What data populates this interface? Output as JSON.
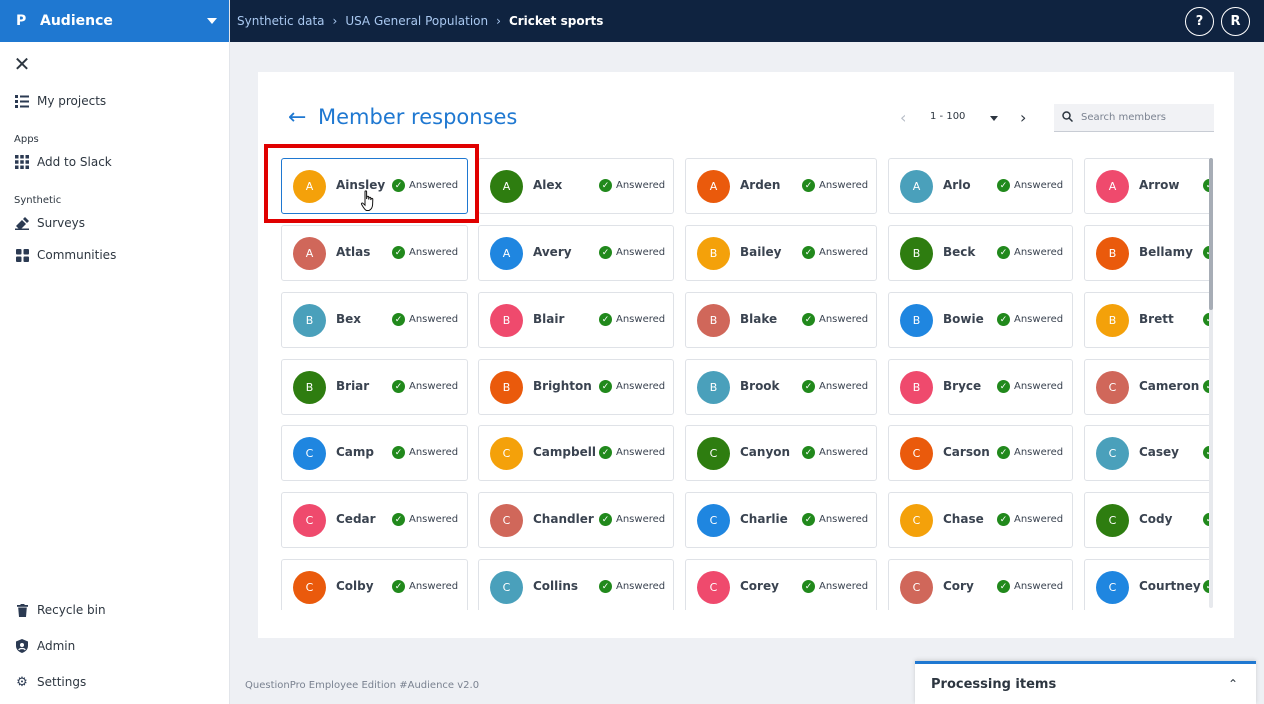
{
  "app": {
    "logo": "P",
    "name": "Audience"
  },
  "sidebar": {
    "close_icon": "close-icon",
    "my_projects": "My projects",
    "apps_section": "Apps",
    "add_to_slack": "Add to Slack",
    "synthetic_section": "Synthetic",
    "surveys": "Surveys",
    "communities": "Communities",
    "recycle_bin": "Recycle bin",
    "admin": "Admin",
    "settings": "Settings"
  },
  "breadcrumb": [
    "Synthetic data",
    "USA General Population",
    "Cricket sports"
  ],
  "topbar": {
    "help": "?",
    "user_initial": "R"
  },
  "page": {
    "title": "Member responses",
    "pager_range": "1 - 100",
    "search_placeholder": "Search members"
  },
  "status_label": "Answered",
  "colors": {
    "accent": "#1f78d1",
    "topbar": "#0f2340",
    "answered": "#21891c",
    "highlight": "#e00000"
  },
  "members": [
    [
      {
        "initial": "A",
        "name": "Ainsley",
        "color": "#f4a10a"
      },
      {
        "initial": "A",
        "name": "Alex",
        "color": "#2e7d10"
      },
      {
        "initial": "A",
        "name": "Arden",
        "color": "#ea5a0c"
      },
      {
        "initial": "A",
        "name": "Arlo",
        "color": "#4aa0bb"
      },
      {
        "initial": "A",
        "name": "Arrow",
        "color": "#ef4a6d"
      }
    ],
    [
      {
        "initial": "A",
        "name": "Atlas",
        "color": "#d0675a"
      },
      {
        "initial": "A",
        "name": "Avery",
        "color": "#1f86e0"
      },
      {
        "initial": "B",
        "name": "Bailey",
        "color": "#f4a10a"
      },
      {
        "initial": "B",
        "name": "Beck",
        "color": "#2e7d10"
      },
      {
        "initial": "B",
        "name": "Bellamy",
        "color": "#ea5a0c"
      }
    ],
    [
      {
        "initial": "B",
        "name": "Bex",
        "color": "#4aa0bb"
      },
      {
        "initial": "B",
        "name": "Blair",
        "color": "#ef4a6d"
      },
      {
        "initial": "B",
        "name": "Blake",
        "color": "#d0675a"
      },
      {
        "initial": "B",
        "name": "Bowie",
        "color": "#1f86e0"
      },
      {
        "initial": "B",
        "name": "Brett",
        "color": "#f4a10a"
      }
    ],
    [
      {
        "initial": "B",
        "name": "Briar",
        "color": "#2e7d10"
      },
      {
        "initial": "B",
        "name": "Brighton",
        "color": "#ea5a0c"
      },
      {
        "initial": "B",
        "name": "Brook",
        "color": "#4aa0bb"
      },
      {
        "initial": "B",
        "name": "Bryce",
        "color": "#ef4a6d"
      },
      {
        "initial": "C",
        "name": "Cameron",
        "color": "#d0675a"
      }
    ],
    [
      {
        "initial": "C",
        "name": "Camp",
        "color": "#1f86e0"
      },
      {
        "initial": "C",
        "name": "Campbell",
        "color": "#f4a10a"
      },
      {
        "initial": "C",
        "name": "Canyon",
        "color": "#2e7d10"
      },
      {
        "initial": "C",
        "name": "Carson",
        "color": "#ea5a0c"
      },
      {
        "initial": "C",
        "name": "Casey",
        "color": "#4aa0bb"
      }
    ],
    [
      {
        "initial": "C",
        "name": "Cedar",
        "color": "#ef4a6d"
      },
      {
        "initial": "C",
        "name": "Chandler",
        "color": "#d0675a"
      },
      {
        "initial": "C",
        "name": "Charlie",
        "color": "#1f86e0"
      },
      {
        "initial": "C",
        "name": "Chase",
        "color": "#f4a10a"
      },
      {
        "initial": "C",
        "name": "Cody",
        "color": "#2e7d10"
      }
    ],
    [
      {
        "initial": "C",
        "name": "Colby",
        "color": "#ea5a0c"
      },
      {
        "initial": "C",
        "name": "Collins",
        "color": "#4aa0bb"
      },
      {
        "initial": "C",
        "name": "Corey",
        "color": "#ef4a6d"
      },
      {
        "initial": "C",
        "name": "Cory",
        "color": "#d0675a"
      },
      {
        "initial": "C",
        "name": "Courtney",
        "color": "#1f86e0"
      }
    ]
  ],
  "footer": {
    "text": "QuestionPro Employee Edition  #Audience v2.0"
  },
  "processing": {
    "title": "Processing items"
  }
}
